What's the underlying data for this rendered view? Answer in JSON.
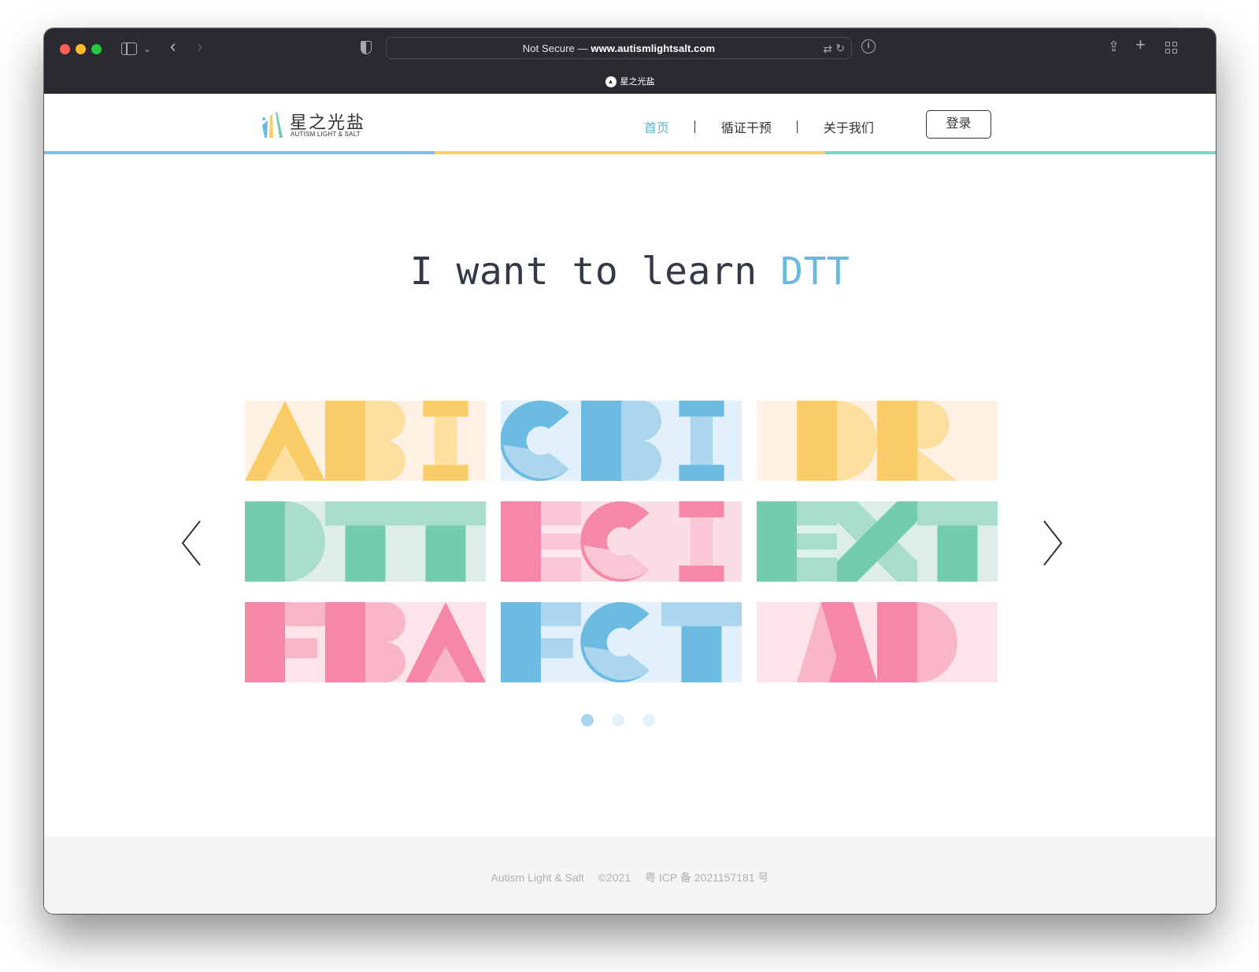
{
  "browser": {
    "address_prefix": "Not Secure — ",
    "address_domain": "www.autismlightsalt.com",
    "tab_title": "星之光盐",
    "icons": [
      "sidebar-icon",
      "chevron-down-icon",
      "back-icon",
      "forward-icon",
      "shield-icon",
      "translate-icon",
      "reload-icon",
      "info-icon",
      "share-icon",
      "new-tab-icon",
      "tab-overview-icon"
    ]
  },
  "header": {
    "logo_cn": "星之光盐",
    "logo_en": "AUTISM LIGHT & SALT",
    "nav": [
      {
        "label": "首页",
        "active": true
      },
      {
        "label": "循证干预",
        "active": false
      },
      {
        "label": "关于我们",
        "active": false
      }
    ],
    "login_label": "登录",
    "bar_colors": [
      "#7fbde3",
      "#f8cf6b",
      "#7fd3c0"
    ]
  },
  "hero": {
    "prefix": "I want to learn ",
    "highlight": "DTT"
  },
  "grid": {
    "tiles": [
      {
        "label": "ABI",
        "bg": "#fff2e4",
        "colors": [
          "#fbcd68",
          "#fde0a0"
        ]
      },
      {
        "label": "CBI",
        "bg": "#e1f0fa",
        "colors": [
          "#6cbbe0",
          "#acd6ee"
        ]
      },
      {
        "label": "DR",
        "bg": "#fff2e4",
        "colors": [
          "#fbcd68",
          "#fde0a0"
        ]
      },
      {
        "label": "DTT",
        "bg": "#dceee7",
        "colors": [
          "#74ccb0",
          "#a7ddca"
        ]
      },
      {
        "label": "ECI",
        "bg": "#fbdde5",
        "colors": [
          "#f588a6",
          "#f9c6d5"
        ]
      },
      {
        "label": "EXT",
        "bg": "#dceee7",
        "colors": [
          "#74ccb0",
          "#a7ddca"
        ]
      },
      {
        "label": "FBA",
        "bg": "#fde4ea",
        "colors": [
          "#f588a6",
          "#f9b6c8"
        ]
      },
      {
        "label": "FCT",
        "bg": "#e1f0fa",
        "colors": [
          "#6cbbe0",
          "#acd6ee"
        ]
      },
      {
        "label": "MD",
        "bg": "#fde4ea",
        "colors": [
          "#f588a6",
          "#f9b6c8"
        ]
      }
    ],
    "current_page": 1,
    "page_count": 3,
    "dot_active_color": "#a9d6ef",
    "dot_color": "#e3f1fa",
    "prev_icon": "chevron-left-icon",
    "next_icon": "chevron-right-icon"
  },
  "footer": {
    "org": "Autism Light & Salt",
    "year": "©2021",
    "icp": "粤 ICP 备 2021157181 号"
  }
}
